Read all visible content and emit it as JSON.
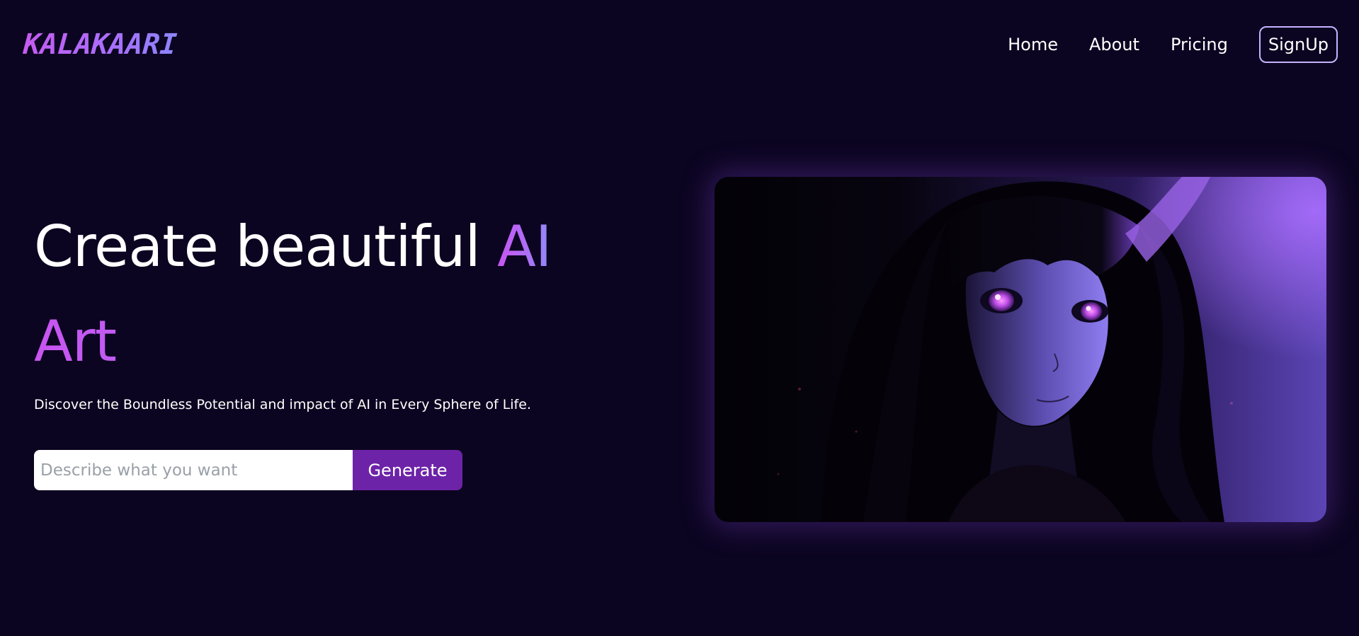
{
  "brand": {
    "logo_text": "KALAKAARI"
  },
  "nav": {
    "items": [
      {
        "label": "Home"
      },
      {
        "label": "About"
      },
      {
        "label": "Pricing"
      }
    ],
    "signup_label": "SignUp"
  },
  "hero": {
    "title_line1": "Create beautiful ",
    "title_accent1": "AI",
    "title_accent2": "Art",
    "subtitle": "Discover the Boundless Potential and impact of AI in Every Sphere of Life.",
    "prompt": {
      "placeholder": "Describe what you want",
      "value": "",
      "button_label": "Generate"
    },
    "image": {
      "subject": "anime-girl-purple-light-illustration"
    }
  },
  "colors": {
    "background": "#0c0521",
    "accent_purple": "#c855f1",
    "accent_blue": "#8f8cf9",
    "button": "#6d23a8",
    "signup_border": "#c7b3ff"
  }
}
